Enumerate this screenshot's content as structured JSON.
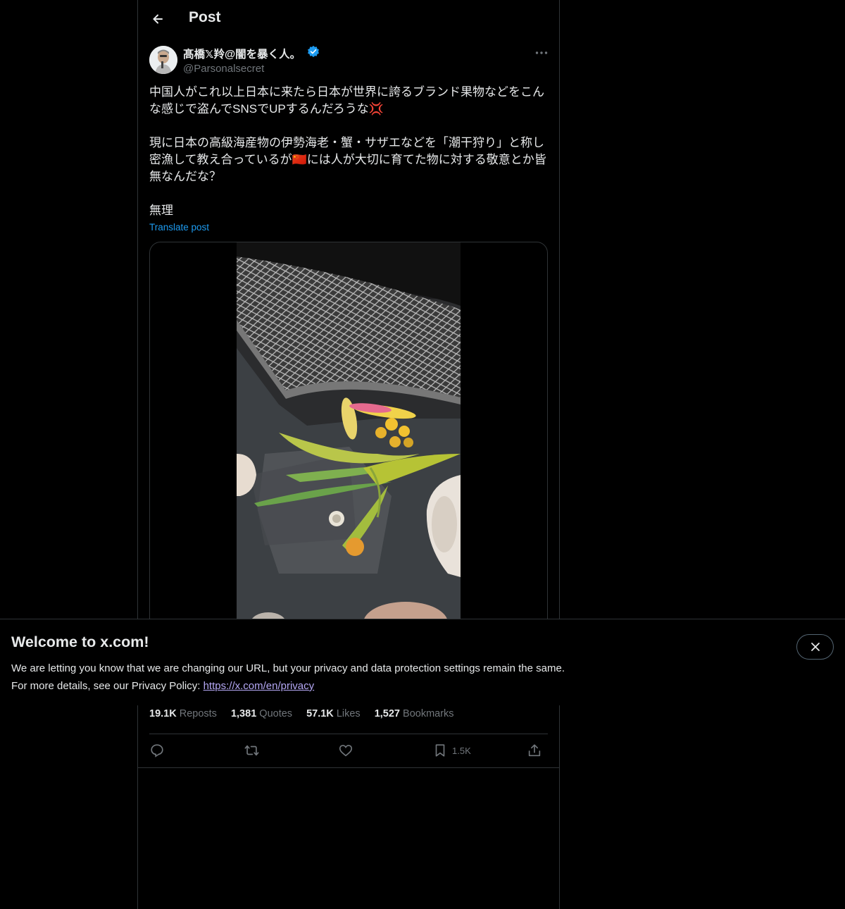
{
  "header": {
    "title": "Post"
  },
  "post": {
    "author_name": "髙橋𝕏羚@闇を暴く人。",
    "handle": "@Parsonalsecret",
    "text": "中国人がこれ以上日本に来たら日本が世界に誇るブランド果物などをこんな感じで盗んでSNSでUPするんだろうな💢\n\n現に日本の高級海産物の伊勢海老・蟹・サザエなどを「潮干狩り」と称し密漁して教え合っているが🇨🇳には人が大切に育てた物に対する敬意とか皆無なんだな？\n\n無理",
    "translate_label": "Translate post"
  },
  "stats": {
    "reposts_count": "19.1K",
    "reposts_label": "Reposts",
    "quotes_count": "1,381",
    "quotes_label": "Quotes",
    "likes_count": "57.1K",
    "likes_label": "Likes",
    "bookmarks_count": "1,527",
    "bookmarks_label": "Bookmarks"
  },
  "actions": {
    "bookmark_count": "1.5K"
  },
  "banner": {
    "title": "Welcome to x.com!",
    "line1": "We are letting you know that we are changing our URL, but your privacy and data protection settings remain the same.",
    "line2": "For more details, see our Privacy Policy: ",
    "link": "https://x.com/en/privacy"
  },
  "icons": {
    "back": "arrow-left-icon",
    "verified": "verified-badge-icon",
    "more": "more-horizontal-icon",
    "reply": "reply-icon",
    "repost": "repost-icon",
    "like": "heart-icon",
    "bookmark": "bookmark-icon",
    "share": "share-icon",
    "close": "close-icon"
  },
  "colors": {
    "accent": "#1d9bf0",
    "background": "#000000",
    "muted": "#71767b",
    "border": "#2f3336"
  }
}
